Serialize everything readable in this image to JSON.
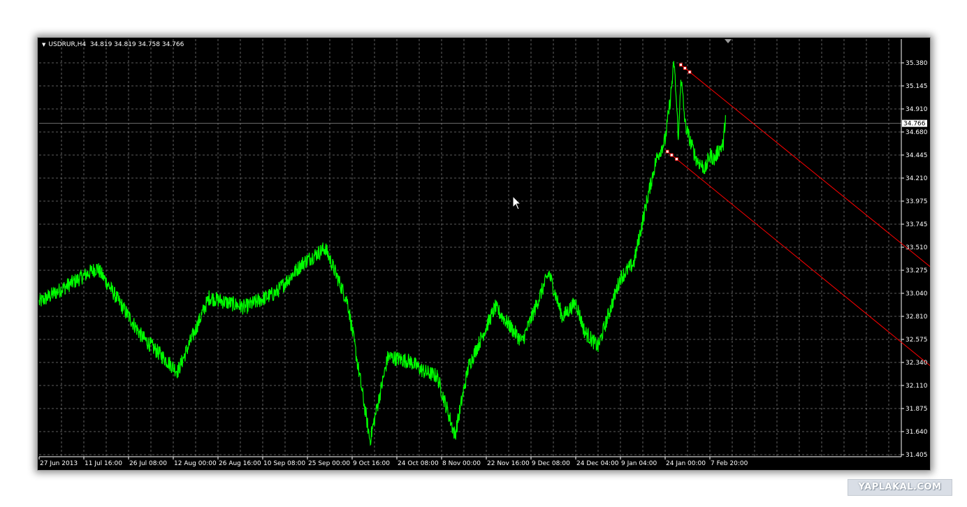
{
  "header": {
    "symbol": "USDRUR,H4",
    "ohlc": "34.819 34.819 34.758 34.766"
  },
  "watermark": "YAPLAKAL.COM",
  "colors": {
    "background": "#000000",
    "price_line": "#00ff00",
    "grid": "#7a7a7a",
    "channel": "#ff0000",
    "current_price_line": "#8c8c8c",
    "axis_text": "#ffffff"
  },
  "chart_data": {
    "type": "line",
    "y_ticks": [
      "35.380",
      "35.145",
      "34.910",
      "34.680",
      "34.445",
      "34.210",
      "33.975",
      "33.745",
      "33.510",
      "33.275",
      "33.040",
      "32.810",
      "32.575",
      "32.340",
      "32.110",
      "31.875",
      "31.640",
      "31.405"
    ],
    "x_ticks": [
      "27 Jun 2013",
      "11 Jul 16:00",
      "26 Jul 08:00",
      "12 Aug 00:00",
      "26 Aug 16:00",
      "10 Sep 08:00",
      "25 Sep 00:00",
      "9 Oct 16:00",
      "24 Oct 08:00",
      "8 Nov 00:00",
      "22 Nov 16:00",
      "9 Dec 08:00",
      "24 Dec 04:00",
      "9 Jan 04:00",
      "24 Jan 00:00",
      "7 Feb 20:00"
    ],
    "ylim": [
      31.405,
      35.38
    ],
    "grid": true,
    "current_price": "34.766",
    "series": [
      {
        "x_index": [
          0,
          1.3,
          2.3,
          3.1,
          3.8,
          4.6,
          5.3,
          5.9,
          6.4,
          6.9,
          7.4,
          7.8,
          8.3,
          8.6,
          8.9,
          9.3,
          9.6,
          10.2,
          10.8,
          11.4,
          11.7,
          12.0,
          12.2,
          12.5,
          13.0,
          13.3,
          13.6,
          13.8,
          14.0,
          14.1,
          14.2,
          14.3,
          14.35,
          14.45,
          14.55,
          14.7,
          14.9,
          15.0,
          15.1,
          15.2,
          15.3,
          15.35
        ],
        "values": [
          32.95,
          33.3,
          32.6,
          32.25,
          33.0,
          32.9,
          33.05,
          33.35,
          33.5,
          32.95,
          31.55,
          32.4,
          32.35,
          32.25,
          32.2,
          31.6,
          32.3,
          32.9,
          32.55,
          33.25,
          32.8,
          32.95,
          32.65,
          32.5,
          33.2,
          33.35,
          34.0,
          34.4,
          34.6,
          34.95,
          35.38,
          34.6,
          35.25,
          34.75,
          34.6,
          34.4,
          34.3,
          34.45,
          34.4,
          34.5,
          34.55,
          34.85
        ]
      }
    ],
    "channel_lines": [
      {
        "x_index": [
          14.35,
          22.0
        ],
        "values": [
          35.36,
          32.55
        ]
      },
      {
        "x_index": [
          14.05,
          22.0
        ],
        "values": [
          34.48,
          31.54
        ]
      }
    ]
  }
}
